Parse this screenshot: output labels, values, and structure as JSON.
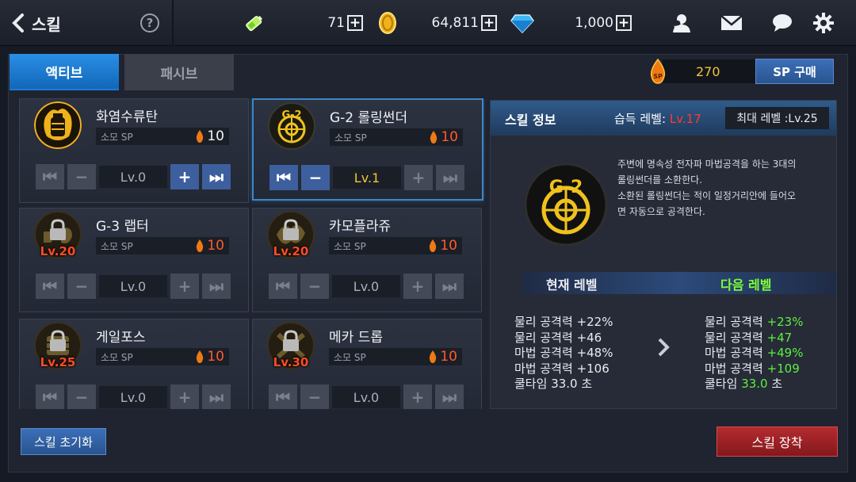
{
  "header": {
    "title": "스킬",
    "help": "?",
    "resources": [
      {
        "icon": "battery-icon",
        "value": "71"
      },
      {
        "icon": "gold-coin-icon",
        "value": "64,811"
      },
      {
        "icon": "diamond-icon",
        "value": "1,000"
      }
    ],
    "plus": "+"
  },
  "tabs": [
    {
      "label": "액티브",
      "active": true
    },
    {
      "label": "패시브",
      "active": false
    }
  ],
  "sp": {
    "icon_label": "SP",
    "value": "270",
    "buy_label": "SP 구매"
  },
  "skills": [
    {
      "name": "화염수류탄",
      "sp_label": "소모 SP",
      "cost": "10",
      "level": "Lv.0",
      "locked": false,
      "selected": false
    },
    {
      "name": "G-2 롤링썬더",
      "sp_label": "소모 SP",
      "cost": "10",
      "level": "Lv.1",
      "locked": false,
      "selected": true
    },
    {
      "name": "G-3 랩터",
      "sp_label": "소모 SP",
      "cost": "10",
      "level": "Lv.0",
      "locked": true,
      "req": "Lv.20",
      "selected": false
    },
    {
      "name": "카모플라쥬",
      "sp_label": "소모 SP",
      "cost": "10",
      "level": "Lv.0",
      "locked": true,
      "req": "Lv.20",
      "selected": false
    },
    {
      "name": "게일포스",
      "sp_label": "소모 SP",
      "cost": "10",
      "level": "Lv.0",
      "locked": true,
      "req": "Lv.25",
      "selected": false
    },
    {
      "name": "메카 드롭",
      "sp_label": "소모 SP",
      "cost": "10",
      "level": "Lv.0",
      "locked": true,
      "req": "Lv.30",
      "selected": false
    }
  ],
  "info": {
    "title": "스킬 정보",
    "acquire_label": "습득 레벨:",
    "acquire_level": "Lv.17",
    "max_level": "최대 레벨 :Lv.25",
    "desc_lines": [
      "주변에 명속성 전자파 마법공격을 하는 3대의",
      "롤링썬더를 소환한다.",
      "소환된 롤링썬더는 적이 일정거리안에 들어오",
      "면 자동으로 공격한다."
    ],
    "current_label": "현재 레벨",
    "next_label": "다음 레벨",
    "current_stats": [
      {
        "label": "물리 공격력",
        "value": "+22%"
      },
      {
        "label": "물리 공격력",
        "value": "+46"
      },
      {
        "label": "마법 공격력",
        "value": "+48%"
      },
      {
        "label": "마법 공격력",
        "value": "+106"
      },
      {
        "label": "쿨타임",
        "value": "33.0 초"
      }
    ],
    "next_stats": [
      {
        "label": "물리 공격력",
        "value": "+23%"
      },
      {
        "label": "물리 공격력",
        "value": "+47"
      },
      {
        "label": "마법 공격력",
        "value": "+49%"
      },
      {
        "label": "마법 공격력",
        "value": "+109"
      },
      {
        "label": "쿨타임",
        "value": "33.0",
        "unit": "초"
      }
    ]
  },
  "buttons": {
    "reset": "스킬 초기화",
    "equip": "스킬 장착"
  }
}
